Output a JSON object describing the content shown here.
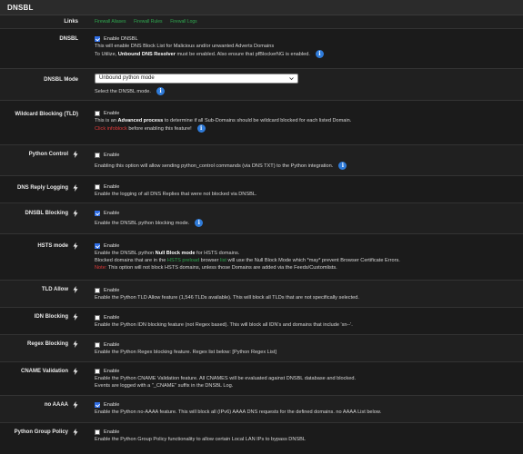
{
  "panel": {
    "title": "DNSBL"
  },
  "links": {
    "label": "Links",
    "items": [
      "Firewall Aliases",
      "Firewall Rules",
      "Firewall Logs"
    ]
  },
  "dnsbl": {
    "label": "DNSBL",
    "checkbox_label": "Enable DNSBL",
    "checked": true,
    "line1": "This will enable DNS Block List for Malicious and/or unwanted Adverts Domains",
    "line2_pre": "To Utilize, ",
    "line2_bold": "Unbound DNS Resolver",
    "line2_post": " must be enabled. Also ensure that pfBlockerNG is enabled."
  },
  "mode": {
    "label": "DNSBL Mode",
    "value": "Unbound python mode",
    "help": "Select the DNSBL mode."
  },
  "wildcard": {
    "label": "Wildcard Blocking (TLD)",
    "checkbox_label": "Enable",
    "checked": false,
    "line1_pre": "This is an ",
    "line1_bold": "Advanced process",
    "line1_post": " to determine if all Sub-Domains should be wildcard blocked for each listed Domain.",
    "line2_red": "Click infoblock",
    "line2_post": " before enabling this feature!"
  },
  "python_control": {
    "label": "Python Control",
    "checkbox_label": "Enable",
    "checked": false,
    "help": "Enabling this option will allow sending python_control commands (via DNS TXT) to the Python integration."
  },
  "dns_reply": {
    "label": "DNS Reply Logging",
    "checkbox_label": "Enable",
    "checked": false,
    "help": "Enable the logging of all DNS Replies that were not blocked via DNSBL."
  },
  "dnsbl_blocking": {
    "label": "DNSBL Blocking",
    "checkbox_label": "Enable",
    "checked": true,
    "help": "Enable the DNSBL python blocking mode."
  },
  "hsts": {
    "label": "HSTS mode",
    "checkbox_label": "Enable",
    "checked": true,
    "line1_pre": "Enable the DNSBL python ",
    "line1_bold": "Null Block mode",
    "line1_post": " for HSTS domains.",
    "line2_pre": "Blocked domains that are in the ",
    "line2_green1": "HSTS preload",
    "line2_mid": " browser ",
    "line2_green2": "list",
    "line2_post": " will use the Null Block Mode which *may* prevent Browser Certificate Errors.",
    "line3_red": "Note:",
    "line3_post": " This option will not block HSTS domains, unless those Domains are added via the Feeds/Customlists."
  },
  "tld_allow": {
    "label": "TLD Allow",
    "checkbox_label": "Enable",
    "checked": false,
    "help": "Enable the Python TLD Allow feature (1,546 TLDs available). This will block all TLDs that are not specifically selected."
  },
  "idn": {
    "label": "IDN Blocking",
    "checkbox_label": "Enable",
    "checked": false,
    "help": "Enable the Python IDN blocking feature (not Regex based). This will block all IDN's and domains that include 'xn--'."
  },
  "regex": {
    "label": "Regex Blocking",
    "checkbox_label": "Enable",
    "checked": false,
    "help": "Enable the Python Regex blocking feature. Regex list below: [Python Regex List]"
  },
  "cname": {
    "label": "CNAME Validation",
    "checkbox_label": "Enable",
    "checked": false,
    "line1": "Enable the Python CNAME Validation feature. All CNAMES will be evaluated against DNSBL database and blocked.",
    "line2": "Events are logged with a \"_CNAME\" suffix in the DNSBL Log."
  },
  "no_aaaa": {
    "label": "no AAAA",
    "checkbox_label": "Enable",
    "checked": true,
    "help": "Enable the Python no-AAAA feature. This will block all (IPv6) AAAA DNS requests for the defined domains. no AAAA List below."
  },
  "group_policy": {
    "label": "Python Group Policy",
    "checkbox_label": "Enable",
    "checked": false,
    "help": "Enable the Python Group Policy functionality to allow certain Local LAN IPs to bypass DNSBL"
  },
  "colors": {
    "accent": "#2f6ee6",
    "info": "#2f7bd9",
    "warning": "#e03a3a",
    "link": "#2fa84f"
  }
}
